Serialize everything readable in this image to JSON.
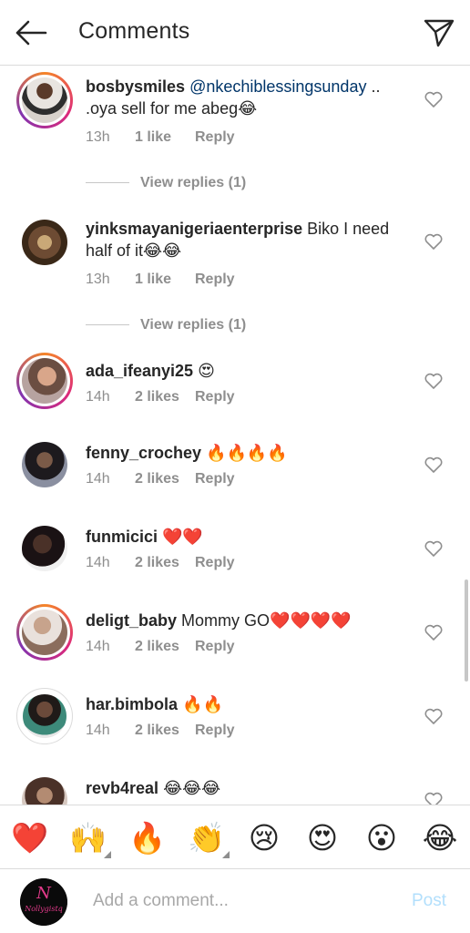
{
  "header": {
    "title": "Comments",
    "back_icon": "arrow-left-icon",
    "send_icon": "paper-plane-icon"
  },
  "comments": [
    {
      "username": "bosbysmiles",
      "mention": "@nkechiblessingsunday",
      "text": " ..\n.oya sell for me abeg😂",
      "time": "13h",
      "likes": "1 like",
      "reply": "Reply",
      "view_replies": "View replies (1)"
    },
    {
      "username": "yinksmayanigeriaenterprise",
      "text": " Biko I need half of it😂😂",
      "time": "13h",
      "likes": "1 like",
      "reply": "Reply",
      "view_replies": "View replies (1)"
    },
    {
      "username": "ada_ifeanyi25",
      "text": " 😍",
      "time": "14h",
      "likes": "2 likes",
      "reply": "Reply"
    },
    {
      "username": "fenny_crochey",
      "text": " 🔥🔥🔥🔥",
      "time": "14h",
      "likes": "2 likes",
      "reply": "Reply"
    },
    {
      "username": "funmicici",
      "text": " ❤️❤️",
      "time": "14h",
      "likes": "2 likes",
      "reply": "Reply"
    },
    {
      "username": "deligt_baby",
      "text": " Mommy GO❤️❤️❤️❤️",
      "time": "14h",
      "likes": "2 likes",
      "reply": "Reply"
    },
    {
      "username": "har.bimbola",
      "text": " 🔥🔥",
      "time": "14h",
      "likes": "2 likes",
      "reply": "Reply"
    },
    {
      "username": "revb4real",
      "text": " 😂😂😂"
    }
  ],
  "emoji_bar": [
    "❤️",
    "🙌",
    "🔥",
    "👏",
    "😢",
    "😍",
    "😮",
    "😂"
  ],
  "composer": {
    "placeholder": "Add a comment...",
    "post_label": "Post",
    "avatar_text": "Nollygistq"
  },
  "colors": {
    "mention": "#003569",
    "meta": "#8e8e8e",
    "post_disabled": "#b2dffc",
    "story_ring": "#dd2a7b"
  }
}
